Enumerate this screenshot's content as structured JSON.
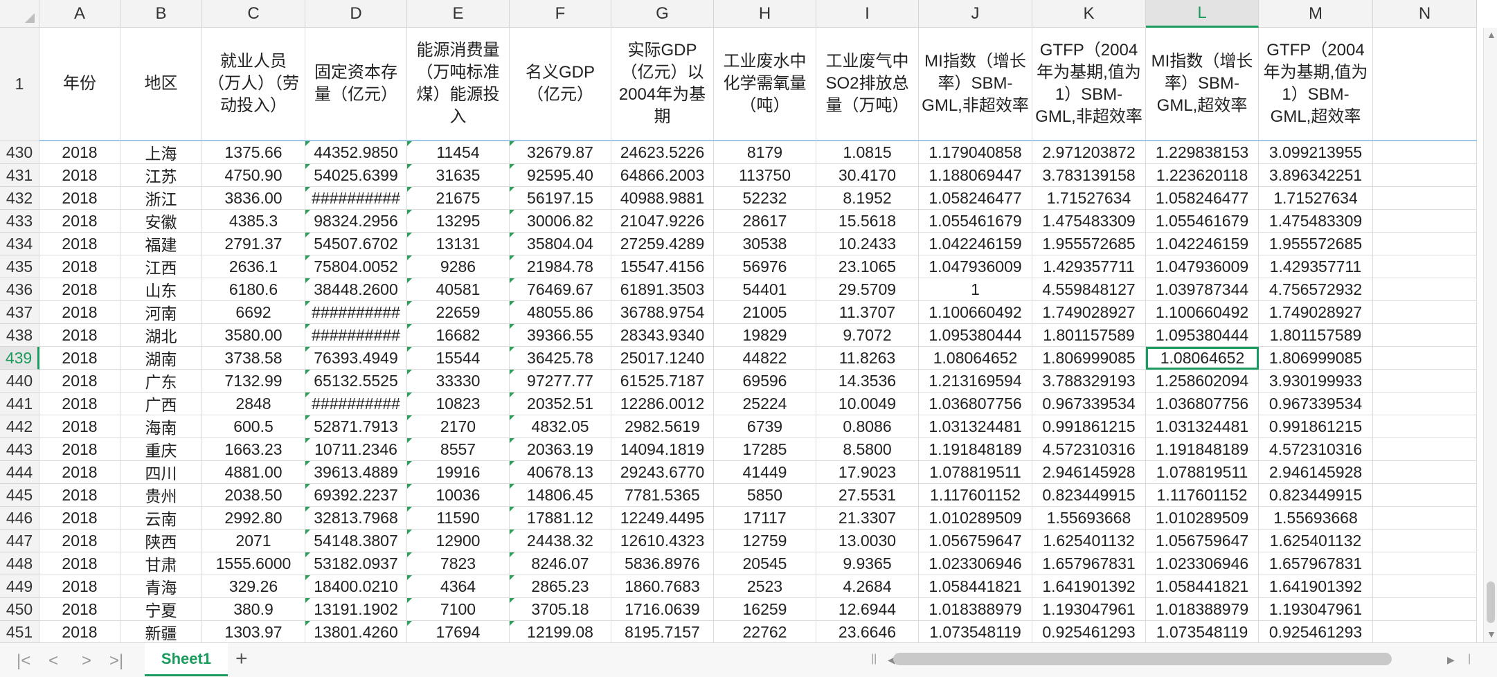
{
  "columns": [
    "A",
    "B",
    "C",
    "D",
    "E",
    "F",
    "G",
    "H",
    "I",
    "J",
    "K",
    "L",
    "M",
    "N"
  ],
  "selected_column": "L",
  "selected_row": "439",
  "header_row_number": "1",
  "headers": [
    "年份",
    "地区",
    "就业人员（万人）（劳动投入）",
    "固定资本存量（亿元）",
    "能源消费量（万吨标准煤）能源投入",
    "名义GDP（亿元）",
    "实际GDP（亿元）以2004年为基期",
    "工业废水中化学需氧量（吨）",
    "工业废气中SO2排放总量（万吨）",
    "MI指数（增长率）SBM-GML,非超效率",
    "GTFP（2004年为基期,值为1）SBM-GML,非超效率",
    "MI指数（增长率）SBM-GML,超效率",
    "GTFP（2004年为基期,值为1）SBM-GML,超效率"
  ],
  "rows": [
    {
      "n": "430",
      "c": [
        "2018",
        "上海",
        "1375.66",
        "44352.9850",
        "11454",
        "32679.87",
        "24623.5226",
        "8179",
        "1.0815",
        "1.179040858",
        "2.971203872",
        "1.229838153",
        "3.099213955"
      ]
    },
    {
      "n": "431",
      "c": [
        "2018",
        "江苏",
        "4750.90",
        "54025.6399",
        "31635",
        "92595.40",
        "64866.2003",
        "113750",
        "30.4170",
        "1.188069447",
        "3.783139158",
        "1.223620118",
        "3.896342251"
      ]
    },
    {
      "n": "432",
      "c": [
        "2018",
        "浙江",
        "3836.00",
        "##########",
        "21675",
        "56197.15",
        "40988.9881",
        "52232",
        "8.1952",
        "1.058246477",
        "1.71527634",
        "1.058246477",
        "1.71527634"
      ]
    },
    {
      "n": "433",
      "c": [
        "2018",
        "安徽",
        "4385.3",
        "98324.2956",
        "13295",
        "30006.82",
        "21047.9226",
        "28617",
        "15.5618",
        "1.055461679",
        "1.475483309",
        "1.055461679",
        "1.475483309"
      ]
    },
    {
      "n": "434",
      "c": [
        "2018",
        "福建",
        "2791.37",
        "54507.6702",
        "13131",
        "35804.04",
        "27259.4289",
        "30538",
        "10.2433",
        "1.042246159",
        "1.955572685",
        "1.042246159",
        "1.955572685"
      ]
    },
    {
      "n": "435",
      "c": [
        "2018",
        "江西",
        "2636.1",
        "75804.0052",
        "9286",
        "21984.78",
        "15547.4156",
        "56976",
        "23.1065",
        "1.047936009",
        "1.429357711",
        "1.047936009",
        "1.429357711"
      ]
    },
    {
      "n": "436",
      "c": [
        "2018",
        "山东",
        "6180.6",
        "38448.2600",
        "40581",
        "76469.67",
        "61891.3503",
        "54401",
        "29.5709",
        "1",
        "4.559848127",
        "1.039787344",
        "4.756572932"
      ]
    },
    {
      "n": "437",
      "c": [
        "2018",
        "河南",
        "6692",
        "##########",
        "22659",
        "48055.86",
        "36788.9754",
        "21005",
        "11.3707",
        "1.100660492",
        "1.749028927",
        "1.100660492",
        "1.749028927"
      ]
    },
    {
      "n": "438",
      "c": [
        "2018",
        "湖北",
        "3580.00",
        "##########",
        "16682",
        "39366.55",
        "28343.9340",
        "19829",
        "9.7072",
        "1.095380444",
        "1.801157589",
        "1.095380444",
        "1.801157589"
      ]
    },
    {
      "n": "439",
      "c": [
        "2018",
        "湖南",
        "3738.58",
        "76393.4949",
        "15544",
        "36425.78",
        "25017.1240",
        "44822",
        "11.8263",
        "1.08064652",
        "1.806999085",
        "1.08064652",
        "1.806999085"
      ]
    },
    {
      "n": "440",
      "c": [
        "2018",
        "广东",
        "7132.99",
        "65132.5525",
        "33330",
        "97277.77",
        "61525.7187",
        "69596",
        "14.3536",
        "1.213169594",
        "3.788329193",
        "1.258602094",
        "3.930199933"
      ]
    },
    {
      "n": "441",
      "c": [
        "2018",
        "广西",
        "2848",
        "##########",
        "10823",
        "20352.51",
        "12286.0012",
        "25224",
        "10.0049",
        "1.036807756",
        "0.967339534",
        "1.036807756",
        "0.967339534"
      ]
    },
    {
      "n": "442",
      "c": [
        "2018",
        "海南",
        "600.5",
        "52871.7913",
        "2170",
        "4832.05",
        "2982.5619",
        "6739",
        "0.8086",
        "1.031324481",
        "0.991861215",
        "1.031324481",
        "0.991861215"
      ]
    },
    {
      "n": "443",
      "c": [
        "2018",
        "重庆",
        "1663.23",
        "10711.2346",
        "8557",
        "20363.19",
        "14094.1819",
        "17285",
        "8.5800",
        "1.191848189",
        "4.572310316",
        "1.191848189",
        "4.572310316"
      ]
    },
    {
      "n": "444",
      "c": [
        "2018",
        "四川",
        "4881.00",
        "39613.4889",
        "19916",
        "40678.13",
        "29243.6770",
        "41449",
        "17.9023",
        "1.078819511",
        "2.946145928",
        "1.078819511",
        "2.946145928"
      ]
    },
    {
      "n": "445",
      "c": [
        "2018",
        "贵州",
        "2038.50",
        "69392.2237",
        "10036",
        "14806.45",
        "7781.5365",
        "5850",
        "27.5531",
        "1.117601152",
        "0.823449915",
        "1.117601152",
        "0.823449915"
      ]
    },
    {
      "n": "446",
      "c": [
        "2018",
        "云南",
        "2992.80",
        "32813.7968",
        "11590",
        "17881.12",
        "12249.4495",
        "17117",
        "21.3307",
        "1.010289509",
        "1.55693668",
        "1.010289509",
        "1.55693668"
      ]
    },
    {
      "n": "447",
      "c": [
        "2018",
        "陕西",
        "2071",
        "54148.3807",
        "12900",
        "24438.32",
        "12610.4323",
        "12759",
        "13.0030",
        "1.056759647",
        "1.625401132",
        "1.056759647",
        "1.625401132"
      ]
    },
    {
      "n": "448",
      "c": [
        "2018",
        "甘肃",
        "1555.6000",
        "53182.0937",
        "7823",
        "8246.07",
        "5836.8976",
        "20545",
        "9.9365",
        "1.023306946",
        "1.657967831",
        "1.023306946",
        "1.657967831"
      ]
    },
    {
      "n": "449",
      "c": [
        "2018",
        "青海",
        "329.26",
        "18400.0210",
        "4364",
        "2865.23",
        "1860.7683",
        "2523",
        "4.2684",
        "1.058441821",
        "1.641901392",
        "1.058441821",
        "1.641901392"
      ]
    },
    {
      "n": "450",
      "c": [
        "2018",
        "宁夏",
        "380.9",
        "13191.1902",
        "7100",
        "3705.18",
        "1716.0639",
        "16259",
        "12.6944",
        "1.018388979",
        "1.193047961",
        "1.018388979",
        "1.193047961"
      ]
    },
    {
      "n": "451",
      "c": [
        "2018",
        "新疆",
        "1303.97",
        "13801.4260",
        "17694",
        "12199.08",
        "8195.7157",
        "22762",
        "23.6646",
        "1.073548119",
        "0.925461293",
        "1.073548119",
        "0.925461293"
      ]
    }
  ],
  "sheet_tab": "Sheet1",
  "add_tab_label": "+"
}
